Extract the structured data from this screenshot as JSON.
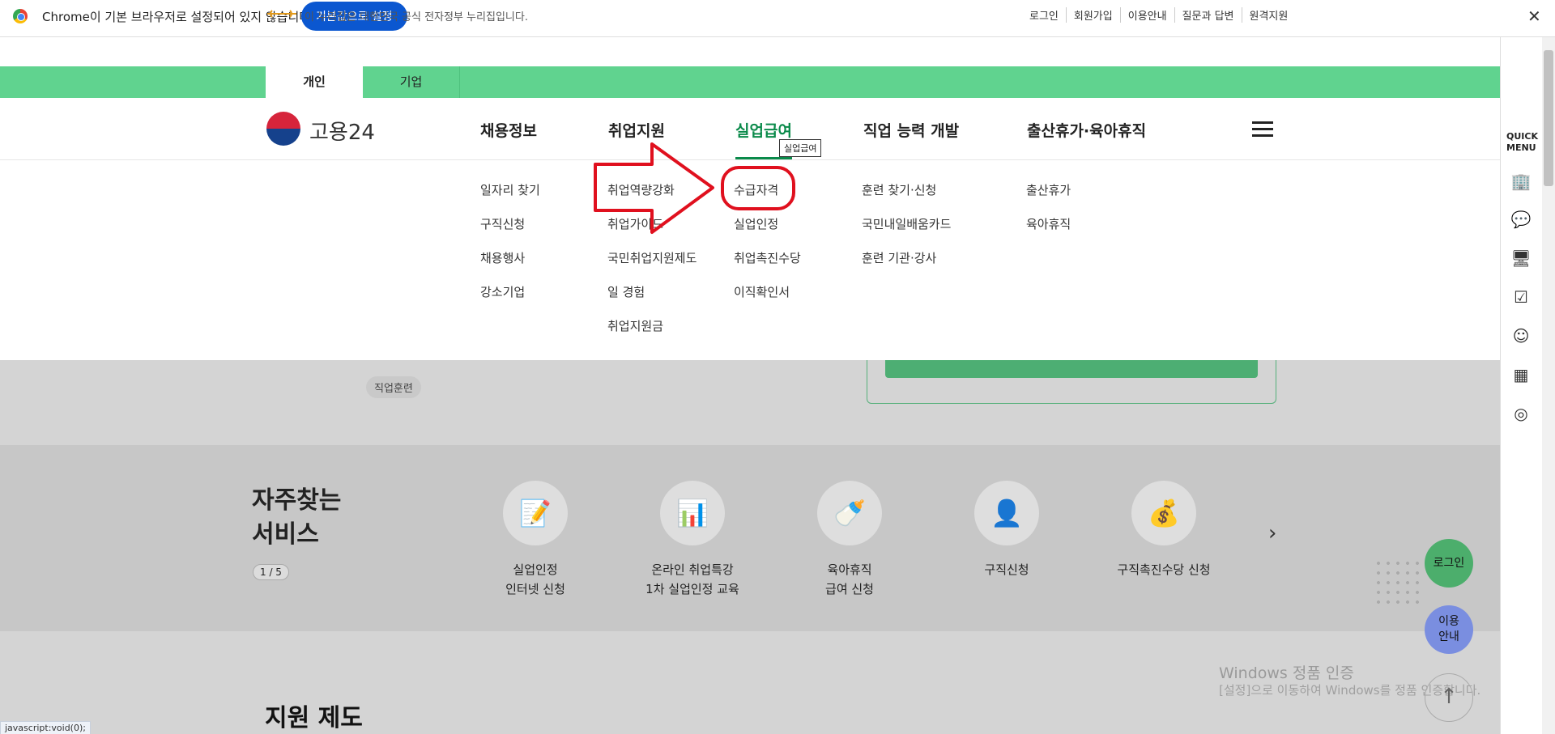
{
  "infobar": {
    "message": "Chrome이 기본 브라우저로 설정되어 있지 않습니다",
    "button": "기본값으로 설정",
    "close": "✕"
  },
  "govbar": {
    "message": "이 누리집은 대한민국 공식 전자정부 누리집입니다.",
    "links": [
      "로그인",
      "회원가입",
      "이용안내",
      "질문과 답변",
      "원격지원"
    ]
  },
  "tabs": [
    "개인",
    "기업"
  ],
  "site": {
    "name": "고용24"
  },
  "gnb": [
    "채용정보",
    "취업지원",
    "실업급여",
    "직업 능력 개발",
    "출산휴가·육아휴직"
  ],
  "tooltip": "실업급여",
  "submenu": {
    "col1": [
      "일자리 찾기",
      "구직신청",
      "채용행사",
      "강소기업"
    ],
    "col2": [
      "취업역량강화",
      "취업가이드",
      "국민취업지원제도",
      "일 경험",
      "취업지원금"
    ],
    "col3": [
      "수급자격",
      "실업인정",
      "취업촉진수당",
      "이직확인서"
    ],
    "col4": [
      "훈련 찾기·신청",
      "국민내일배움카드",
      "훈련 기관·강사"
    ],
    "col5": [
      "출산휴가",
      "육아휴직"
    ]
  },
  "chip": "직업훈련",
  "services": {
    "title_line1": "자주찾는",
    "title_line2": "서비스",
    "pager": "1 / 5",
    "items": [
      {
        "line1": "실업인정",
        "line2": "인터넷 신청",
        "icon": "document-pen-icon"
      },
      {
        "line1": "온라인 취업특강",
        "line2": "1차 실업인정 교육",
        "icon": "presentation-board-icon"
      },
      {
        "line1": "육아휴직",
        "line2": "급여 신청",
        "icon": "baby-bottle-icon"
      },
      {
        "line1": "구직신청",
        "line2": "",
        "icon": "person-pen-icon"
      },
      {
        "line1": "구직촉진수당 신청",
        "line2": "",
        "icon": "money-bag-icon"
      }
    ]
  },
  "support_title": "지원 제도",
  "floating": {
    "login": "로그인",
    "guide_line1": "이용",
    "guide_line2": "안내"
  },
  "quick_menu": {
    "title_line1": "QUICK",
    "title_line2": "MENU"
  },
  "watermark": {
    "line1": "Windows 정품 인증",
    "line2": "[설정]으로 이동하여 Windows를 정품 인증합니다."
  },
  "status_bar": "javascript:void(0);",
  "colors": {
    "green": "#60d38f",
    "active": "#0a8a4a",
    "annotation": "#e0101e"
  }
}
